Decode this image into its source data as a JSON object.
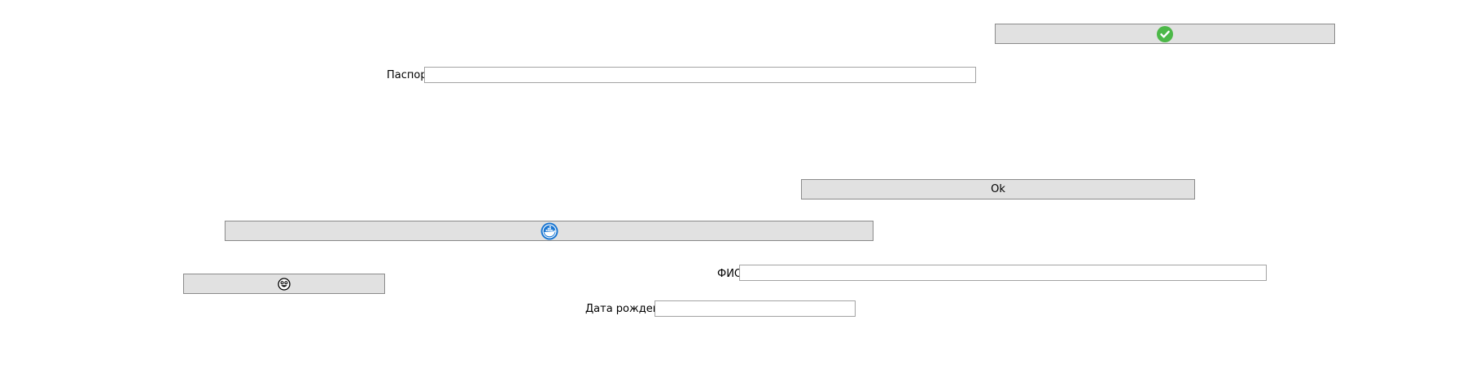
{
  "form": {
    "confirm_button": {
      "icon": "green-checkmark-icon",
      "icon_color": "#4cb848"
    },
    "passport": {
      "label": "Паспорт",
      "value": "",
      "placeholder": ""
    },
    "ok_button": {
      "label": "Ok"
    },
    "cloud_button": {
      "icon": "blue-round-docker-whale-icon",
      "icon_color": "#1976d2"
    },
    "smiley_button": {
      "icon": "smiley-face-icon"
    },
    "fio": {
      "label": "ФИО",
      "value": "",
      "placeholder": ""
    },
    "birth_date": {
      "label": "Дата рождения",
      "value": "",
      "placeholder": ""
    }
  },
  "colors": {
    "button_bg": "#e1e1e1",
    "button_border": "#8a8a8a",
    "field_border": "#a3a3a3",
    "background": "#ffffff"
  }
}
